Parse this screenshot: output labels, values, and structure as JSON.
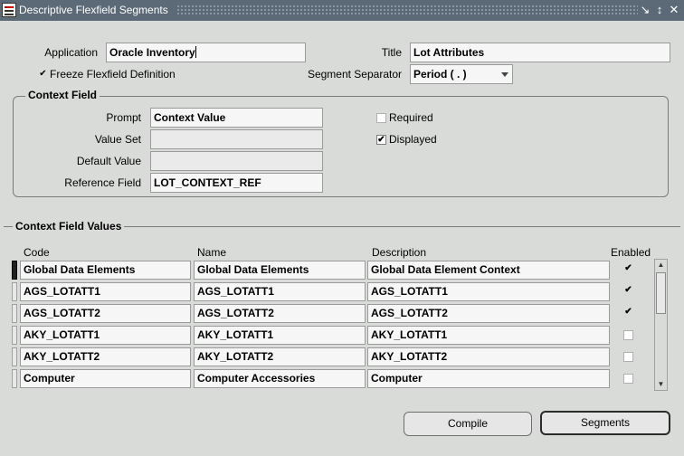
{
  "window": {
    "title": "Descriptive Flexfield Segments"
  },
  "header": {
    "application_label": "Application",
    "application_value": "Oracle Inventory",
    "title_label": "Title",
    "title_value": "Lot Attributes",
    "freeze_label": "Freeze Flexfield Definition",
    "freeze_checked": true,
    "separator_label": "Segment Separator",
    "separator_value": "Period ( . )"
  },
  "context_field": {
    "group_title": "Context Field",
    "prompt_label": "Prompt",
    "prompt_value": "Context Value",
    "value_set_label": "Value Set",
    "value_set_value": "",
    "default_value_label": "Default Value",
    "default_value_value": "",
    "reference_field_label": "Reference Field",
    "reference_field_value": "LOT_CONTEXT_REF",
    "required_label": "Required",
    "required_checked": false,
    "displayed_label": "Displayed",
    "displayed_checked": true
  },
  "context_values": {
    "group_title": "Context Field Values",
    "columns": {
      "code": "Code",
      "name": "Name",
      "description": "Description",
      "enabled": "Enabled"
    },
    "rows": [
      {
        "code": "Global Data Elements",
        "name": "Global Data Elements",
        "description": "Global Data Element Context",
        "enabled": true
      },
      {
        "code": "AGS_LOTATT1",
        "name": "AGS_LOTATT1",
        "description": "AGS_LOTATT1",
        "enabled": true
      },
      {
        "code": "AGS_LOTATT2",
        "name": "AGS_LOTATT2",
        "description": "AGS_LOTATT2",
        "enabled": true
      },
      {
        "code": "AKY_LOTATT1",
        "name": "AKY_LOTATT1",
        "description": "AKY_LOTATT1",
        "enabled": false
      },
      {
        "code": "AKY_LOTATT2",
        "name": "AKY_LOTATT2",
        "description": "AKY_LOTATT2",
        "enabled": false
      },
      {
        "code": "Computer",
        "name": "Computer Accessories",
        "description": "Computer",
        "enabled": false
      }
    ]
  },
  "buttons": {
    "compile": "Compile",
    "segments": "Segments"
  }
}
